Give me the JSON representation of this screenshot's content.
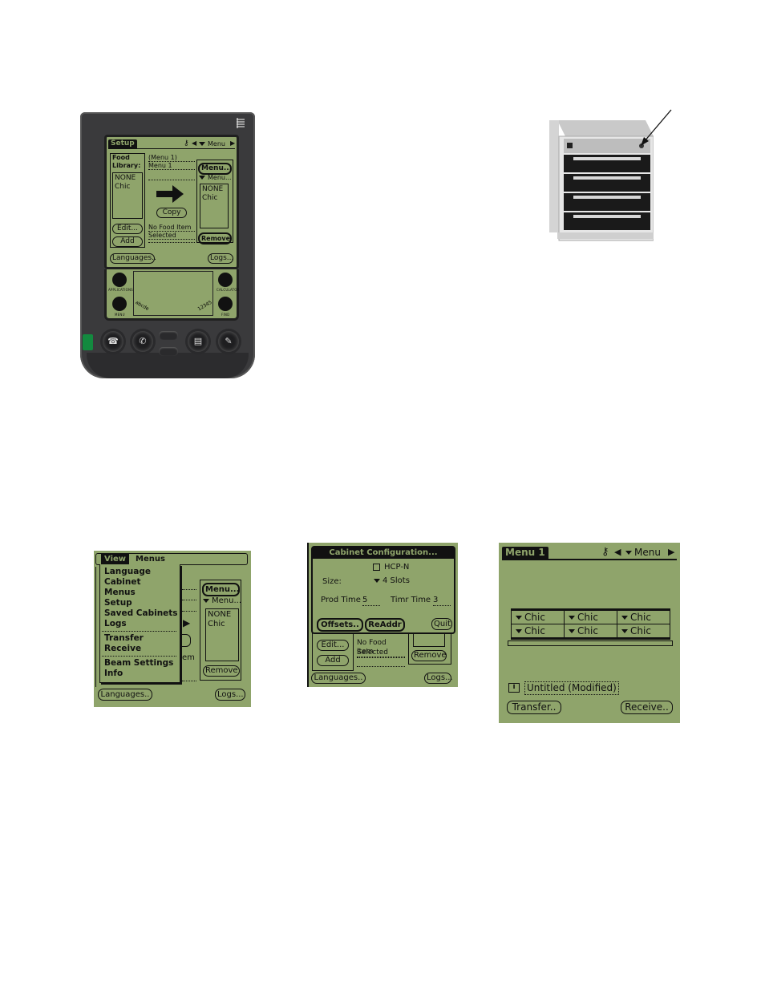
{
  "device": {
    "logo_icon": "palm-logo-icon",
    "screen": {
      "title": "Setup",
      "header_icons": [
        "key-icon",
        "left-arrow-icon"
      ],
      "header_dropdown": "Menu",
      "food_library_label": "Food Library:",
      "food_library_items": [
        "NONE",
        "Chic"
      ],
      "menu_name_line1": "(Menu 1)",
      "menu_name_line2": "Menu 1",
      "menu_button": "Menu...",
      "menu_dropdown": "Menu...",
      "menu_items": [
        "NONE",
        "Chic"
      ],
      "copy_button": "Copy",
      "status_line1": "No Food Item",
      "status_line2": "Selected",
      "edit_button": "Edit...",
      "add_button": "Add",
      "remove_button": "Remove",
      "languages_button": "Languages..",
      "logs_button": "Logs..."
    },
    "silkscreen": {
      "applications": "APPLICATIONS",
      "calculator": "CALCULATOR",
      "menu": "MENU",
      "find": "FIND",
      "letters": "abcde",
      "numbers": "12345"
    },
    "hardware_buttons": [
      "date-book-icon",
      "address-phone-icon",
      "todo-icon",
      "memo-icon"
    ]
  },
  "cabinet_photo": {
    "arrow_icon": "pointer-arrow-icon",
    "slots": 4
  },
  "shot1": {
    "menubar": [
      "View",
      "Menus"
    ],
    "menu_items": [
      "Language",
      "Cabinet",
      "Menus",
      "Setup",
      "Saved Cabinets",
      "Logs"
    ],
    "menu_items_2": [
      "Transfer",
      "Receive"
    ],
    "menu_items_3": [
      "Beam Settings",
      "Info"
    ],
    "menu_button": "Menu...",
    "menu_dropdown": "Menu...",
    "list_items": [
      "NONE",
      "Chic"
    ],
    "partial_text": "em",
    "remove_button": "Remove",
    "languages_button": "Languages..",
    "logs_button": "Logs..."
  },
  "shot2": {
    "dialog_title": "Cabinet Configuration...",
    "checkbox_label": "HCP-N",
    "checkbox_checked": false,
    "size_label": "Size:",
    "size_value": "4 Slots",
    "prod_time_label": "Prod Time",
    "prod_time_value": "5",
    "timr_time_label": "Timr Time",
    "timr_time_value": "3",
    "offsets_button": "Offsets..",
    "readdr_button": "ReAddr",
    "quit_button": "Quit",
    "edit_button": "Edit...",
    "add_button": "Add",
    "status_line1": "No Food Item",
    "status_line2": "Selected",
    "remove_button": "Remove",
    "languages_button": "Languages..",
    "logs_button": "Logs..."
  },
  "shot3": {
    "title": "Menu 1",
    "header_dropdown": "Menu",
    "grid": [
      [
        "Chic",
        "Chic",
        "Chic"
      ],
      [
        "Chic",
        "Chic",
        "Chic"
      ]
    ],
    "file_name": "Untitled (Modified)",
    "transfer_button": "Transfer..",
    "receive_button": "Receive.."
  }
}
